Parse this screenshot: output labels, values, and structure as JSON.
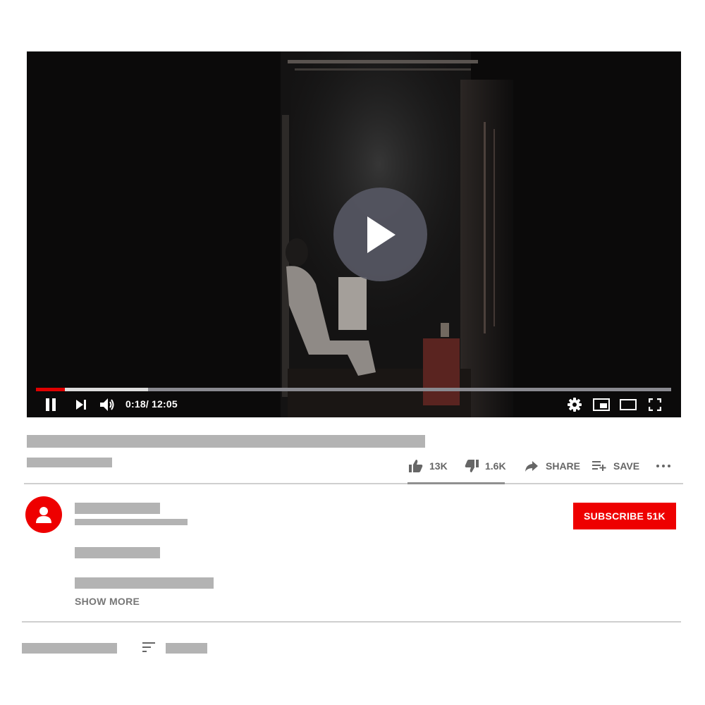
{
  "player": {
    "time_display": "0:18/ 12:05",
    "progress_fraction": 0.046,
    "buffer_fraction": 0.177,
    "center_icon": "play-icon",
    "controls": [
      "pause-icon",
      "next-icon",
      "volume-icon",
      "settings-icon",
      "miniplayer-icon",
      "theater-mode-icon",
      "fullscreen-icon"
    ]
  },
  "actions": {
    "like_count": "13K",
    "dislike_count": "1.6K",
    "share_label": "SHARE",
    "save_label": "SAVE",
    "more_icon": "more-options-icon"
  },
  "channel": {
    "avatar_icon": "user-avatar-icon",
    "subscribe_label": "SUBSCRIBE 51K"
  },
  "description": {
    "show_more_label": "SHOW MORE"
  },
  "comments": {
    "sort_icon": "sort-icon"
  },
  "colors": {
    "accent_red": "#ee0000",
    "progress_red": "#e00000",
    "placeholder_gray": "#b3b3b3",
    "play_button_bg": "#565763"
  }
}
